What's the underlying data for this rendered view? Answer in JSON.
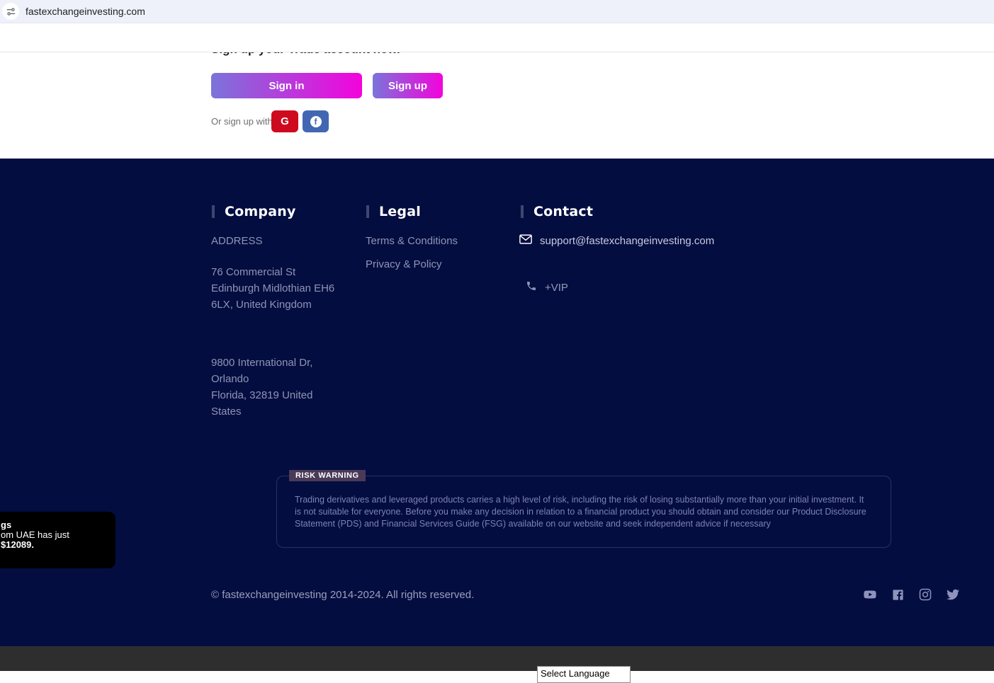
{
  "browser": {
    "url": "fastexchangeinvesting.com"
  },
  "cta": {
    "heading": "Sign up your Trade account now.",
    "signin": "Sign in",
    "signup": "Sign up",
    "or_text": "Or sign up with",
    "google_initial": "G",
    "facebook_initial": "f"
  },
  "footer": {
    "company": {
      "title": "Company",
      "address_label": "ADDRESS",
      "uk_address": [
        "76 Commercial St",
        "Edinburgh Midlothian EH6",
        "6LX, United Kingdom"
      ],
      "us_address": [
        "9800 International Dr,",
        "Orlando",
        "Florida, 32819 United",
        "States"
      ]
    },
    "legal": {
      "title": "Legal",
      "links": [
        "Terms & Conditions",
        "Privacy & Policy"
      ]
    },
    "contact": {
      "title": "Contact",
      "email": "support@fastexchangeinvesting.com",
      "phone": "+VIP"
    },
    "risk": {
      "label": "RISK WARNING",
      "text": "Trading derivatives and leveraged products carries a high level of risk, including the risk of losing substantially more than your initial investment. It is not suitable for everyone. Before you make any decision in relation to a financial product you should obtain and consider our Product Disclosure Statement (PDS) and Financial Services Guide (FSG) available on our website and seek independent advice if necessary"
    },
    "copyright": "© fastexchangeinvesting 2014-2024. All rights reserved.",
    "social": [
      "youtube",
      "facebook",
      "instagram",
      "twitter"
    ]
  },
  "toast": {
    "line1": "gs",
    "line2": "om UAE has just",
    "line3": "$12089."
  },
  "language_bar": {
    "select_value": "Select Language"
  },
  "colors": {
    "footer_navy": "#040d40",
    "gradient_start": "#7b74da",
    "gradient_end": "#f303dc",
    "google_red": "#ce0a1e",
    "facebook_blue": "#4267b2",
    "risk_label_bg": "#4a3a58",
    "bottom_bar": "#2e2e2e"
  }
}
